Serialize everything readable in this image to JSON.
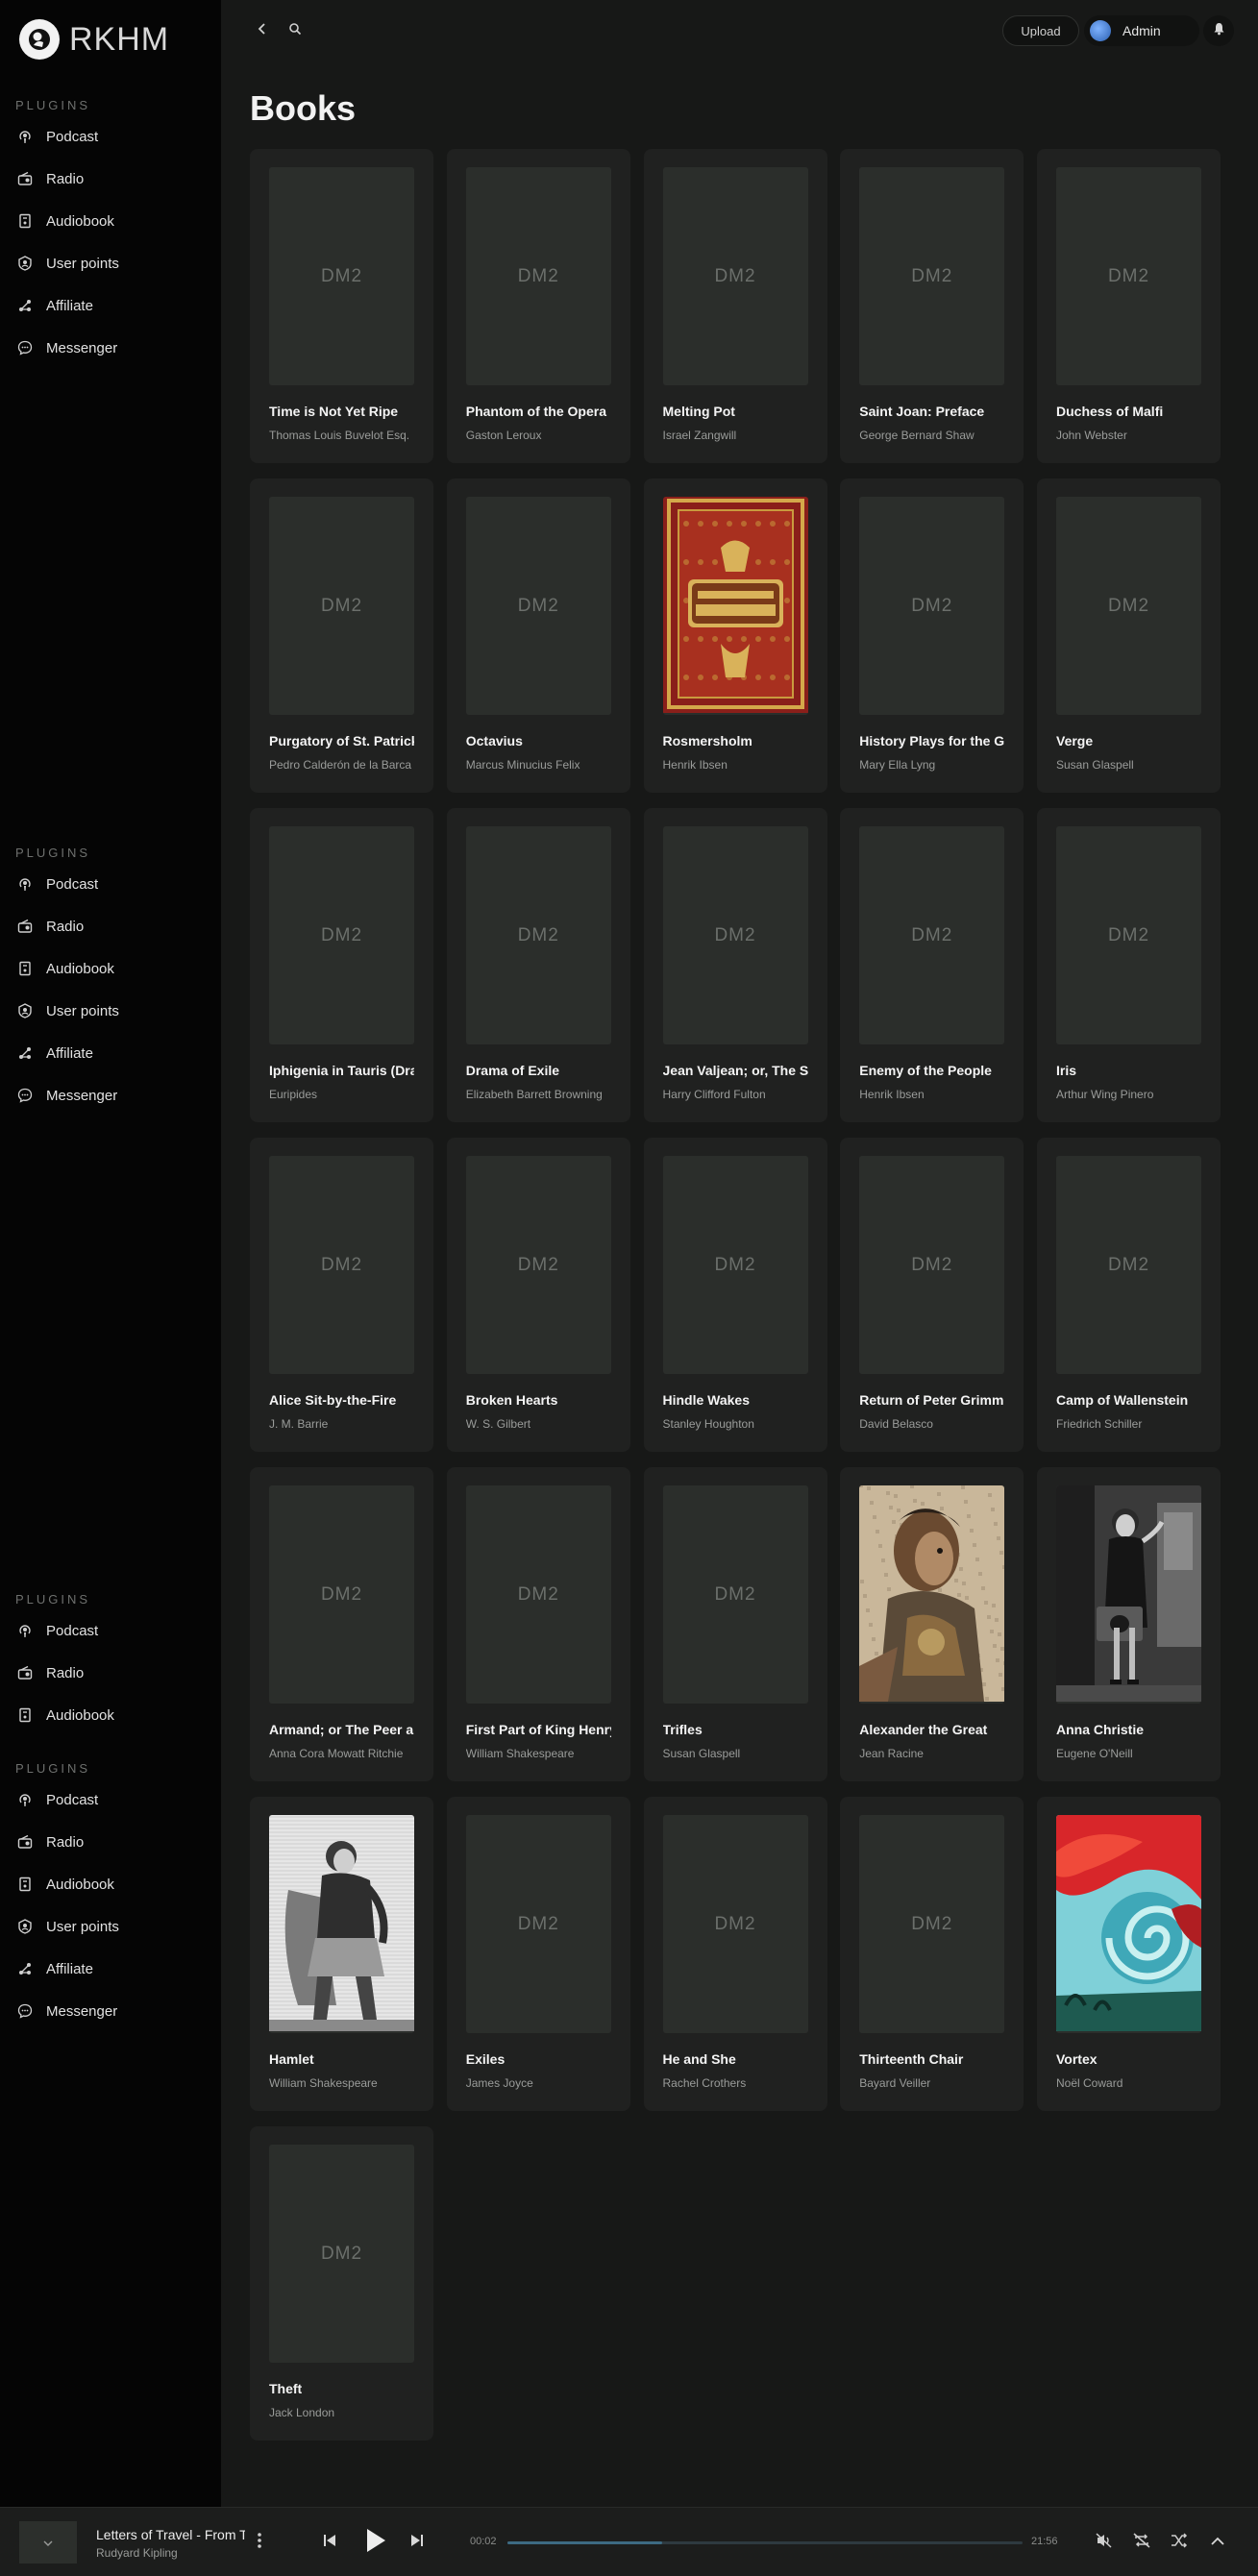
{
  "app": {
    "brand": "RKHM"
  },
  "plugin_sections": [
    {
      "heading": "PLUGINS",
      "items": [
        {
          "label": "Podcast",
          "icon": "podcast-icon"
        },
        {
          "label": "Radio",
          "icon": "radio-icon"
        },
        {
          "label": "Audiobook",
          "icon": "audiobook-icon"
        },
        {
          "label": "User points",
          "icon": "user-points-icon"
        },
        {
          "label": "Affiliate",
          "icon": "affiliate-icon"
        },
        {
          "label": "Messenger",
          "icon": "messenger-icon"
        }
      ]
    },
    {
      "heading": "PLUGINS",
      "items": [
        {
          "label": "Podcast",
          "icon": "podcast-icon"
        },
        {
          "label": "Radio",
          "icon": "radio-icon"
        },
        {
          "label": "Audiobook",
          "icon": "audiobook-icon"
        },
        {
          "label": "User points",
          "icon": "user-points-icon"
        },
        {
          "label": "Affiliate",
          "icon": "affiliate-icon"
        },
        {
          "label": "Messenger",
          "icon": "messenger-icon"
        }
      ]
    },
    {
      "heading": "PLUGINS",
      "items": [
        {
          "label": "Podcast",
          "icon": "podcast-icon"
        },
        {
          "label": "Radio",
          "icon": "radio-icon"
        },
        {
          "label": "Audiobook",
          "icon": "audiobook-icon"
        }
      ]
    },
    {
      "heading": "PLUGINS",
      "items": [
        {
          "label": "Podcast",
          "icon": "podcast-icon"
        },
        {
          "label": "Radio",
          "icon": "radio-icon"
        },
        {
          "label": "Audiobook",
          "icon": "audiobook-icon"
        },
        {
          "label": "User points",
          "icon": "user-points-icon"
        },
        {
          "label": "Affiliate",
          "icon": "affiliate-icon"
        },
        {
          "label": "Messenger",
          "icon": "messenger-icon"
        }
      ]
    }
  ],
  "header": {
    "upload_label": "Upload",
    "user_label": "Admin"
  },
  "page": {
    "title": "Books"
  },
  "books": [
    {
      "title": "Time is Not Yet Ripe",
      "author": "Thomas Louis Buvelot Esq.",
      "cover": "placeholder",
      "placeholder_text": "DM2"
    },
    {
      "title": "Phantom of the Opera",
      "author": "Gaston Leroux",
      "cover": "placeholder",
      "placeholder_text": "DM2"
    },
    {
      "title": "Melting Pot",
      "author": "Israel Zangwill",
      "cover": "placeholder",
      "placeholder_text": "DM2"
    },
    {
      "title": "Saint Joan: Preface",
      "author": "George Bernard Shaw",
      "cover": "placeholder",
      "placeholder_text": "DM2"
    },
    {
      "title": "Duchess of Malfi",
      "author": "John Webster",
      "cover": "placeholder",
      "placeholder_text": "DM2"
    },
    {
      "title": "Purgatory of St. Patrick",
      "author": "Pedro Calderón de la Barca",
      "cover": "placeholder",
      "placeholder_text": "DM2"
    },
    {
      "title": "Octavius",
      "author": "Marcus Minucius Felix",
      "cover": "placeholder",
      "placeholder_text": "DM2"
    },
    {
      "title": "Rosmersholm",
      "author": "Henrik Ibsen",
      "cover": "ornate-book",
      "placeholder_text": ""
    },
    {
      "title": "History Plays for the Grammar Grades",
      "author": "Mary Ella Lyng",
      "cover": "placeholder",
      "placeholder_text": "DM2"
    },
    {
      "title": "Verge",
      "author": "Susan Glaspell",
      "cover": "placeholder",
      "placeholder_text": "DM2"
    },
    {
      "title": "Iphigenia in Tauris (Dramatic)",
      "author": "Euripides",
      "cover": "placeholder",
      "placeholder_text": "DM2"
    },
    {
      "title": "Drama of Exile",
      "author": "Elizabeth Barrett Browning",
      "cover": "placeholder",
      "placeholder_text": "DM2"
    },
    {
      "title": "Jean Valjean; or, The Shadow of the Law",
      "author": "Harry Clifford Fulton",
      "cover": "placeholder",
      "placeholder_text": "DM2"
    },
    {
      "title": "Enemy of the People",
      "author": "Henrik Ibsen",
      "cover": "placeholder",
      "placeholder_text": "DM2"
    },
    {
      "title": "Iris",
      "author": "Arthur Wing Pinero",
      "cover": "placeholder",
      "placeholder_text": "DM2"
    },
    {
      "title": "Alice Sit-by-the-Fire",
      "author": "J. M. Barrie",
      "cover": "placeholder",
      "placeholder_text": "DM2"
    },
    {
      "title": "Broken Hearts",
      "author": "W. S. Gilbert",
      "cover": "placeholder",
      "placeholder_text": "DM2"
    },
    {
      "title": "Hindle Wakes",
      "author": "Stanley Houghton",
      "cover": "placeholder",
      "placeholder_text": "DM2"
    },
    {
      "title": "Return of Peter Grimm",
      "author": "David Belasco",
      "cover": "placeholder",
      "placeholder_text": "DM2"
    },
    {
      "title": "Camp of Wallenstein",
      "author": "Friedrich Schiller",
      "cover": "placeholder",
      "placeholder_text": "DM2"
    },
    {
      "title": "Armand; or The Peer and the Peasant",
      "author": "Anna Cora Mowatt Ritchie",
      "cover": "placeholder",
      "placeholder_text": "DM2"
    },
    {
      "title": "First Part of King Henry the Fourth",
      "author": "William Shakespeare",
      "cover": "placeholder",
      "placeholder_text": "DM2"
    },
    {
      "title": "Trifles",
      "author": "Susan Glaspell",
      "cover": "placeholder",
      "placeholder_text": "DM2"
    },
    {
      "title": "Alexander the Great",
      "author": "Jean Racine",
      "cover": "mosaic",
      "placeholder_text": ""
    },
    {
      "title": "Anna Christie",
      "author": "Eugene O'Neill",
      "cover": "photo-woman",
      "placeholder_text": ""
    },
    {
      "title": "Hamlet",
      "author": "William Shakespeare",
      "cover": "engraving-man",
      "placeholder_text": ""
    },
    {
      "title": "Exiles",
      "author": "James Joyce",
      "cover": "placeholder",
      "placeholder_text": "DM2"
    },
    {
      "title": "He and She",
      "author": "Rachel Crothers",
      "cover": "placeholder",
      "placeholder_text": "DM2"
    },
    {
      "title": "Thirteenth Chair",
      "author": "Bayard Veiller",
      "cover": "placeholder",
      "placeholder_text": "DM2"
    },
    {
      "title": "Vortex",
      "author": "Noël Coward",
      "cover": "swirl",
      "placeholder_text": ""
    },
    {
      "title": "Theft",
      "author": "Jack London",
      "cover": "placeholder",
      "placeholder_text": "DM2"
    }
  ],
  "player": {
    "title": "Letters of Travel - From Tideway to Tideway",
    "author": "Rudyard Kipling",
    "elapsed": "00:02",
    "duration": "21:56",
    "progress_fraction": 0.3
  },
  "colors": {
    "background": "#171817",
    "sidebar": "#050505",
    "card": "#202120",
    "progress_fill": "#3d6a82"
  }
}
